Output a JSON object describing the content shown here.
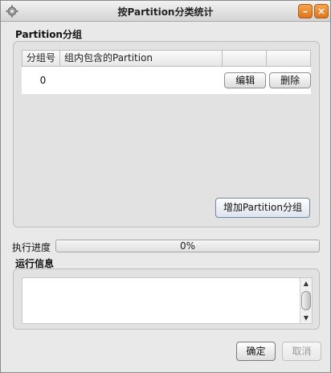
{
  "window": {
    "title": "按Partition分类统计",
    "minimize_label": "–",
    "close_label": "×",
    "app_icon": "gear-icon"
  },
  "partition_group": {
    "title": "Partition分组",
    "columns": [
      "分组号",
      "组内包含的Partition",
      "",
      ""
    ],
    "rows": [
      {
        "group_number": "0",
        "partitions": "",
        "edit_label": "编辑",
        "delete_label": "删除"
      }
    ],
    "add_button_label": "增加Partition分组"
  },
  "progress": {
    "label": "执行进度",
    "value": 0,
    "text": "0%",
    "fill_color": "#6a8fc7"
  },
  "log": {
    "title": "运行信息",
    "content": ""
  },
  "footer": {
    "ok_label": "确定",
    "cancel_label": "取消",
    "cancel_disabled": true
  }
}
